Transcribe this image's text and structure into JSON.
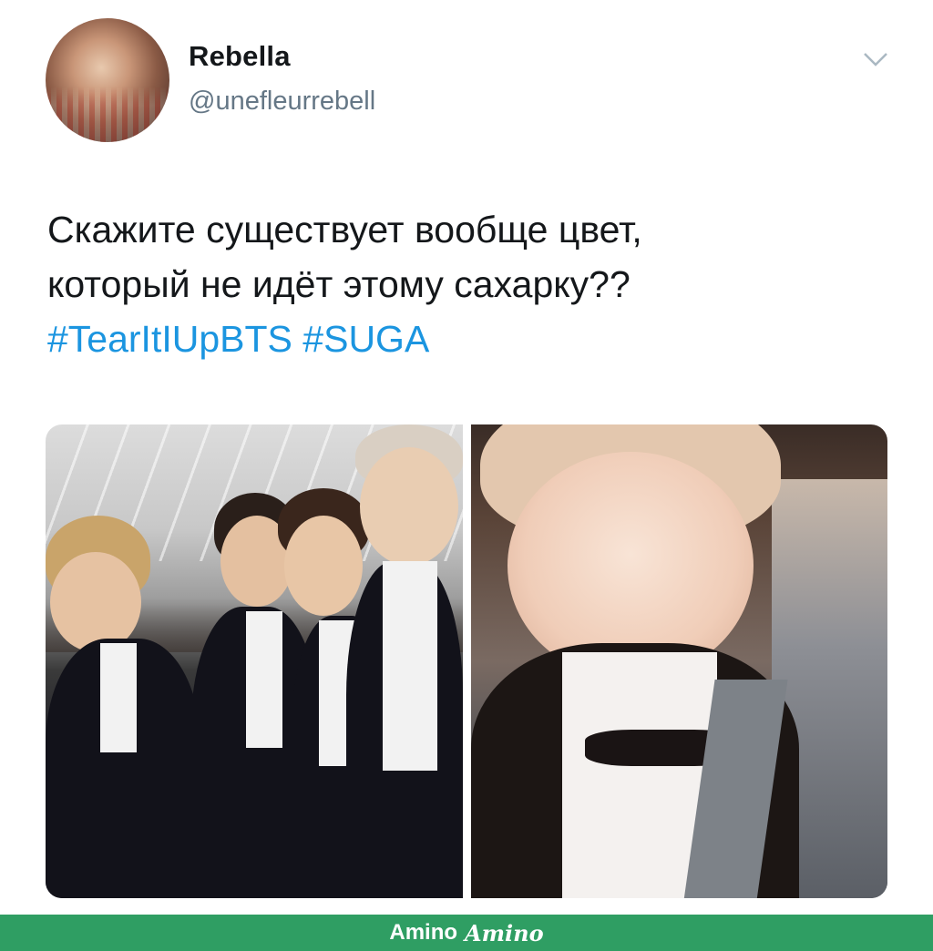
{
  "tweet": {
    "author": {
      "display_name": "Rebella",
      "handle": "@unefleurrebell"
    },
    "text_lines": [
      "Скажите существует вообще цвет,",
      "который не идёт этому сахарку??"
    ],
    "hashtags": [
      "#TearItIUpBTS",
      "#SUGA"
    ],
    "media_count": 2
  },
  "icons": {
    "menu": "chevron-down-icon"
  },
  "footer": {
    "label": "Amino",
    "logo_text": "Amino"
  },
  "colors": {
    "hashtag": "#1b95e0",
    "handle": "#657786",
    "text": "#14171a",
    "footer_bg": "#2f9e63"
  }
}
